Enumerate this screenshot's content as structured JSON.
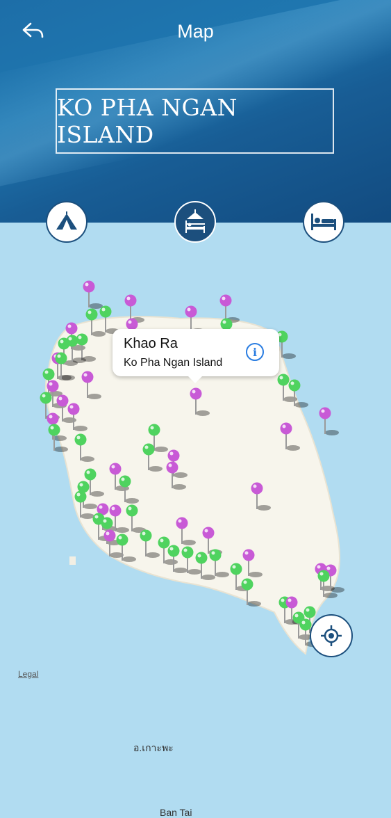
{
  "header": {
    "title": "Map",
    "back_icon": "back-arrow-icon"
  },
  "banner": {
    "text": "KO PHA NGAN ISLAND"
  },
  "categories": [
    {
      "icon": "tent-icon",
      "selected": false
    },
    {
      "icon": "hotel-icon",
      "selected": true
    },
    {
      "icon": "bed-icon",
      "selected": false
    }
  ],
  "map": {
    "place_labels": {
      "town": "อ.เกาะพะ",
      "village": "Ban Tai"
    },
    "callout": {
      "title": "Khao Ra",
      "subtitle": "Ko Pha Ngan Island",
      "info_icon": "info-icon"
    },
    "legal": "Legal",
    "locate_icon": "locate-icon",
    "colors": {
      "water": "#b1dcf1",
      "land": "#f7f5ec",
      "pin_green": "#4fd35f",
      "pin_purple": "#c85ad6"
    }
  }
}
